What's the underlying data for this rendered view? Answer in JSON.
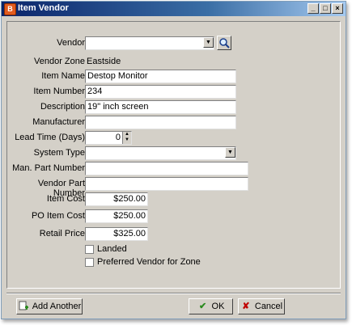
{
  "window": {
    "title": "Item Vendor",
    "app_icon": "B"
  },
  "form": {
    "vendor": {
      "label": "Vendor",
      "value": ""
    },
    "vendor_zone": {
      "label": "Vendor Zone",
      "value": "Eastside"
    },
    "item_name": {
      "label": "Item Name",
      "value": "Destop Monitor"
    },
    "item_number": {
      "label": "Item Number",
      "value": "234"
    },
    "description": {
      "label": "Description",
      "value": "19\" inch screen"
    },
    "manufacturer": {
      "label": "Manufacturer",
      "value": ""
    },
    "lead_time": {
      "label": "Lead Time (Days)",
      "value": "0"
    },
    "system_type": {
      "label": "System Type",
      "value": ""
    },
    "man_part_number": {
      "label": "Man. Part Number",
      "value": ""
    },
    "vendor_part_number": {
      "label": "Vendor Part Number",
      "value": ""
    },
    "item_cost": {
      "label": "Item Cost",
      "value": "$250.00"
    },
    "po_item_cost": {
      "label": "PO Item Cost",
      "value": "$250.00"
    },
    "retail_price": {
      "label": "Retail Price",
      "value": "$325.00"
    },
    "landed": {
      "label": "Landed",
      "checked": false
    },
    "preferred_vendor": {
      "label": "Preferred Vendor for Zone",
      "checked": false
    }
  },
  "buttons": {
    "add_another": "Add Another",
    "ok": "OK",
    "cancel": "Cancel"
  },
  "colors": {
    "titlebar": "#0a246a",
    "ok_check": "#2a8a1e",
    "cancel_x": "#c00000"
  }
}
